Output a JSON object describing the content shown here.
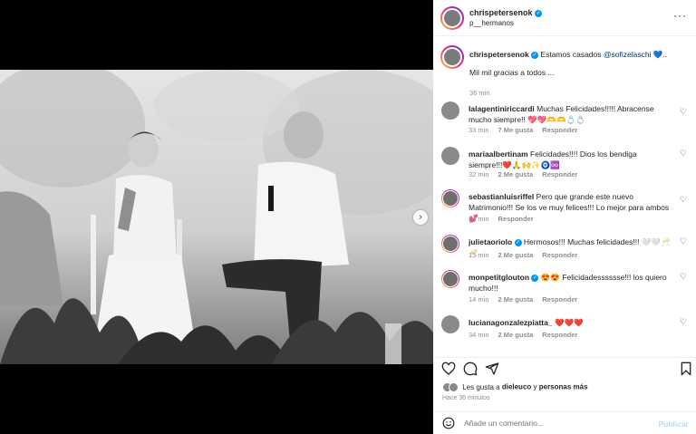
{
  "post": {
    "username": "chrispetersenok",
    "subtitle": "p__hermanos",
    "more": "···"
  },
  "caption": {
    "username": "chrispetersenok",
    "text": "Estamos casados",
    "mention": "@sofizelaschi",
    "emoji": "💙..",
    "line2": "Mil mil gracias a todos ...",
    "time": "36 min"
  },
  "comments": [
    {
      "user": "lalagentiniriccardi",
      "text": "Muchas Felicidades!!!!! Abracense mucho siempre!! 💖💖🫶🫶💍💍",
      "time": "33 min",
      "likes": "7 Me gusta",
      "reply": "Responder"
    },
    {
      "user": "mariaalbertinam",
      "text": "Felicidades!!!! Dios los bendiga siempre!!!❤️🙏🙌✨🧿♾️",
      "time": "32 min",
      "likes": "2 Me gusta",
      "reply": "Responder"
    },
    {
      "user": "sebastianluisriffel",
      "text": "Pero que grande este nuevo Matrimonio!!! Se los ve muy felices!!! Lo mejor para ambos💕",
      "time": "14 min",
      "likes": "",
      "reply": "Responder"
    },
    {
      "user": "julietaoriolo",
      "text": "Hermosos!!! Muchas felicidades!!! 🤍🤍🥂🥂",
      "time": "15 min",
      "likes": "2 Me gusta",
      "reply": "Responder"
    },
    {
      "user": "monpetitglouton",
      "text": "😍😍 Felicidadesssssse!!! los quiero mucho!!!",
      "time": "14 min",
      "likes": "2 Me gusta",
      "reply": "Responder"
    },
    {
      "user": "lucianagonzalezpiatta_",
      "text": "❤️❤️❤️",
      "time": "34 min",
      "likes": "2 Me gusta",
      "reply": "Responder"
    }
  ],
  "likes_text": {
    "prefix": "Les gusta a ",
    "user": "dieleuco",
    "mid": " y ",
    "others": "personas más"
  },
  "posted_ago": "Hace 36 minutos",
  "add_comment": {
    "placeholder": "Añade un comentario...",
    "publish": "Publicar"
  },
  "icons": {
    "like": "heart-icon",
    "comment": "comment-icon",
    "share": "send-icon",
    "save": "bookmark-icon",
    "emoji": "emoji-icon",
    "next": "chevron-right-icon"
  }
}
